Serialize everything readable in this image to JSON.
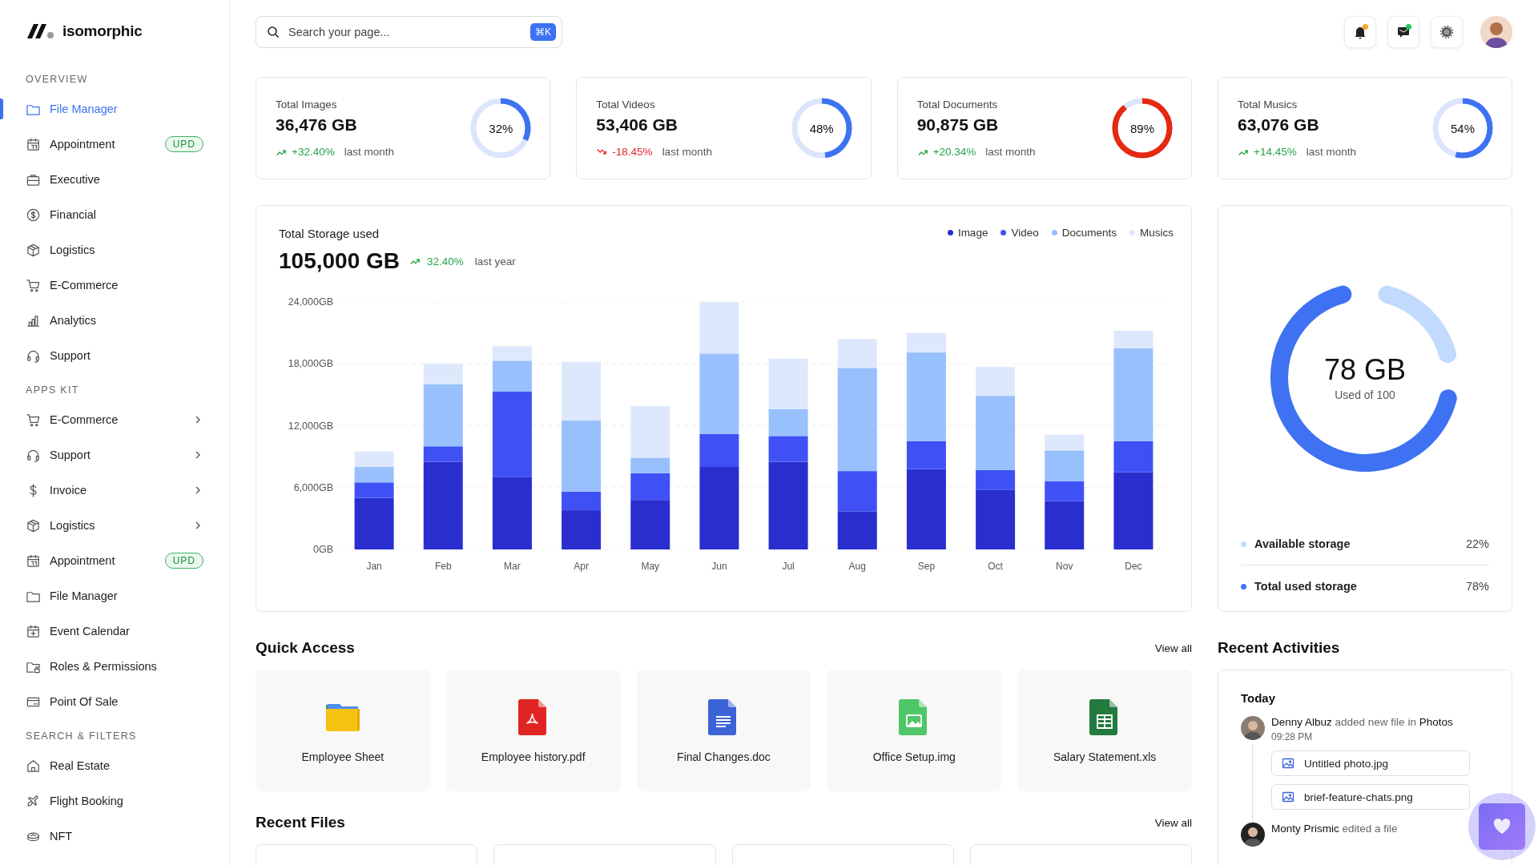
{
  "brand": {
    "name": "isomorphic"
  },
  "sidebar": {
    "sections": [
      {
        "title": "OVERVIEW",
        "items": [
          {
            "label": "File Manager",
            "selected": true,
            "submenu": false
          },
          {
            "label": "Appointment",
            "selected": false,
            "submenu": false,
            "badge": "UPD"
          },
          {
            "label": "Executive",
            "selected": false,
            "submenu": false
          },
          {
            "label": "Financial",
            "selected": false,
            "submenu": false
          },
          {
            "label": "Logistics",
            "selected": false,
            "submenu": false
          },
          {
            "label": "E-Commerce",
            "selected": false,
            "submenu": false
          },
          {
            "label": "Analytics",
            "selected": false,
            "submenu": false
          },
          {
            "label": "Support",
            "selected": false,
            "submenu": false
          }
        ]
      },
      {
        "title": "APPS KIT",
        "items": [
          {
            "label": "E-Commerce",
            "selected": false,
            "submenu": true
          },
          {
            "label": "Support",
            "selected": false,
            "submenu": true
          },
          {
            "label": "Invoice",
            "selected": false,
            "submenu": true
          },
          {
            "label": "Logistics",
            "selected": false,
            "submenu": true
          },
          {
            "label": "Appointment",
            "selected": false,
            "submenu": false,
            "badge": "UPD"
          },
          {
            "label": "File Manager",
            "selected": false,
            "submenu": false
          },
          {
            "label": "Event Calendar",
            "selected": false,
            "submenu": false
          },
          {
            "label": "Roles & Permissions",
            "selected": false,
            "submenu": false
          },
          {
            "label": "Point Of Sale",
            "selected": false,
            "submenu": false
          }
        ]
      },
      {
        "title": "SEARCH & FILTERS",
        "items": [
          {
            "label": "Real Estate",
            "selected": false,
            "submenu": false
          },
          {
            "label": "Flight Booking",
            "selected": false,
            "submenu": false
          },
          {
            "label": "NFT",
            "selected": false,
            "submenu": false
          }
        ]
      }
    ]
  },
  "search": {
    "placeholder": "Search your page...",
    "shortcut": "⌘K"
  },
  "header_icons": [
    {
      "kind": "bell",
      "color": "#f5a524"
    },
    {
      "kind": "message",
      "color": "#22c55e"
    },
    {
      "kind": "settings"
    }
  ],
  "stats": [
    {
      "title": "Total Images",
      "value": "36,476 GB",
      "change": "+32.40%",
      "kind": "up",
      "period": "last month",
      "level": 0.32,
      "percent": "32%",
      "color": "#3d72f2"
    },
    {
      "title": "Total Videos",
      "value": "53,406 GB",
      "change": "-18.45%",
      "kind": "down",
      "period": "last month",
      "level": 0.48,
      "percent": "48%",
      "color": "#3d72f2"
    },
    {
      "title": "Total Documents",
      "value": "90,875 GB",
      "change": "+20.34%",
      "kind": "up",
      "period": "last month",
      "level": 0.89,
      "percent": "89%",
      "color": "#e6290f"
    },
    {
      "title": "Total Musics",
      "value": "63,076 GB",
      "change": "+14.45%",
      "kind": "up",
      "period": "last month",
      "level": 0.54,
      "percent": "54%",
      "color": "#3d72f2"
    }
  ],
  "storage_chart": {
    "title": "Total Storage used",
    "total": "105,000 GB",
    "change": "32.40%",
    "kind": "up",
    "period": "last year",
    "chart_data": {
      "type": "bar",
      "stacked": true,
      "grid": true,
      "categories": [
        "Jan",
        "Feb",
        "Mar",
        "Apr",
        "May",
        "Jun",
        "Jul",
        "Aug",
        "Sep",
        "Oct",
        "Nov",
        "Dec"
      ],
      "series": [
        {
          "name": "Image",
          "color": "#2a2ecf",
          "values": [
            5000,
            8500,
            7000,
            3800,
            4800,
            8000,
            8500,
            3700,
            7800,
            5800,
            4700,
            7500
          ]
        },
        {
          "name": "Video",
          "color": "#3f51f5",
          "values": [
            1500,
            1500,
            8300,
            1800,
            2600,
            3200,
            2500,
            3900,
            2700,
            1900,
            1900,
            3000
          ]
        },
        {
          "name": "Documents",
          "color": "#98c0fd",
          "values": [
            1500,
            6000,
            3000,
            6900,
            1500,
            7800,
            2600,
            10000,
            8600,
            7200,
            3000,
            9000
          ]
        },
        {
          "name": "Musics",
          "color": "#dde8fd",
          "values": [
            1500,
            2000,
            1400,
            5700,
            5000,
            5000,
            4900,
            2800,
            1900,
            2800,
            1550,
            1700
          ]
        }
      ],
      "ylim": [
        0,
        24000
      ],
      "yticks": [
        {
          "value": 0,
          "label": "0GB"
        },
        {
          "value": 6000,
          "label": "6,000GB"
        },
        {
          "value": 12000,
          "label": "12,000GB"
        },
        {
          "value": 18000,
          "label": "18,000GB"
        },
        {
          "value": 24000,
          "label": "24,000GB"
        }
      ]
    }
  },
  "storage_summary": {
    "amount": "78 GB",
    "caption": "Used of 100",
    "chart_data": {
      "type": "donut",
      "categories": [
        "Available storage",
        "Total used storage"
      ],
      "values": [
        22,
        78
      ]
    },
    "legend": [
      {
        "value": "22%",
        "color": "#c2dafd"
      },
      {
        "value": "78%",
        "color": "#3f72f2"
      }
    ]
  },
  "quick_access": {
    "title": "Quick Access",
    "view_all": "View all",
    "files": [
      {
        "name": "Employee Sheet",
        "kind": "folder"
      },
      {
        "name": "Employee history.pdf",
        "kind": "pdf"
      },
      {
        "name": "Final Changes.doc",
        "kind": "doc"
      },
      {
        "name": "Office Setup.img",
        "kind": "image"
      },
      {
        "name": "Salary Statement.xls",
        "kind": "sheet"
      }
    ]
  },
  "recent_files": {
    "title": "Recent Files",
    "view_all": "View all"
  },
  "recent_activities": {
    "title": "Recent Activities",
    "groups": [
      {
        "day": "Today",
        "entries": [
          {
            "text": "**Denny Albuz** added new file in **Photos**",
            "time": "09:28 PM",
            "files": [
              "Untitled photo.jpg",
              "brief-feature-chats.png"
            ]
          },
          {
            "text": "**Monty Prismic** edited a file"
          }
        ]
      }
    ]
  }
}
